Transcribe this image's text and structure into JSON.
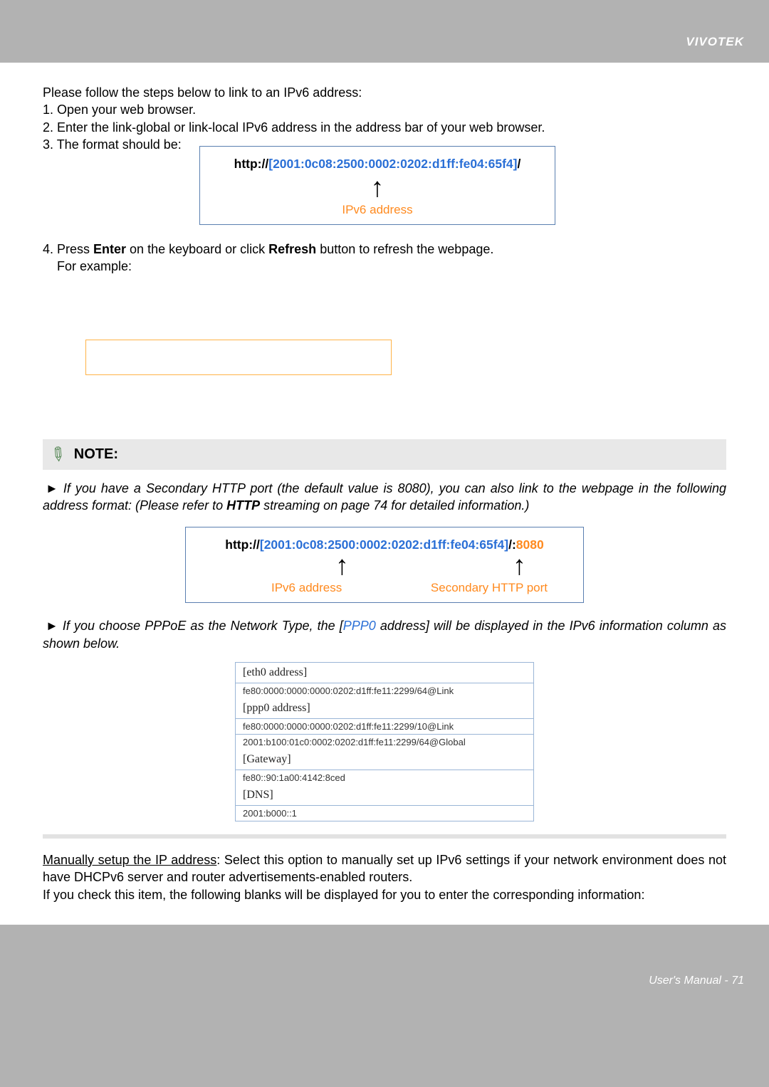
{
  "header": {
    "brand": "VIVOTEK"
  },
  "intro": {
    "lead": "Please follow the steps below to link to an IPv6 address:",
    "step1": "1. Open your web browser.",
    "step2": "2. Enter the link-global or link-local IPv6 address in the address bar of your web browser.",
    "step3": "3. The format should be:",
    "step4_a": "4. Press ",
    "step4_b": "Enter",
    "step4_c": " on the keyboard or click ",
    "step4_d": "Refresh",
    "step4_e": " button to refresh the webpage.",
    "step4_ex": "    For example:"
  },
  "diagram1": {
    "prefix": "http://",
    "open": "[",
    "addr": "2001:0c08:2500:0002:0202:d1ff:fe04:65f4",
    "close": "]",
    "suffix": "/",
    "caption": "IPv6 address"
  },
  "note": {
    "title": "NOTE:",
    "para1_a": "► If you have a Secondary HTTP port (the default value is 8080), you can also link to the webpage in the following address format: (Please refer to ",
    "para1_http": "HTTP",
    "para1_b": " streaming on page 74 for detailed information.)",
    "para2_a": "► If you choose PPPoE as the Network Type, the [",
    "para2_ppp": "PPP0",
    "para2_b": " address] will be displayed in the IPv6 information column as shown below."
  },
  "diagram2": {
    "prefix": "http://",
    "open": "[",
    "addr": "2001:0c08:2500:0002:0202:d1ff:fe04:65f4",
    "close": "]",
    "suffix": "/:",
    "port": "8080",
    "caption1": "IPv6 address",
    "caption2": "Secondary HTTP port"
  },
  "table": {
    "rows": [
      {
        "hdr": "[eth0 address]",
        "vals": [
          "fe80:0000:0000:0000:0202:d1ff:fe11:2299/64@Link"
        ]
      },
      {
        "hdr": "[ppp0 address]",
        "vals": [
          "fe80:0000:0000:0000:0202:d1ff:fe11:2299/10@Link",
          "2001:b100:01c0:0002:0202:d1ff:fe11:2299/64@Global"
        ]
      },
      {
        "hdr": "[Gateway]",
        "vals": [
          "fe80::90:1a00:4142:8ced"
        ]
      },
      {
        "hdr": "[DNS]",
        "vals": [
          "2001:b000::1"
        ]
      }
    ]
  },
  "manual": {
    "title": "Manually setup the IP address",
    "body1": ": Select this option to manually set up IPv6 settings if your network environment does not have DHCPv6 server and router advertisements-enabled routers.",
    "body2": "If you check this item, the following blanks will be displayed for you to enter the corresponding information:"
  },
  "footer": {
    "label": "User's Manual - ",
    "page": "71"
  }
}
